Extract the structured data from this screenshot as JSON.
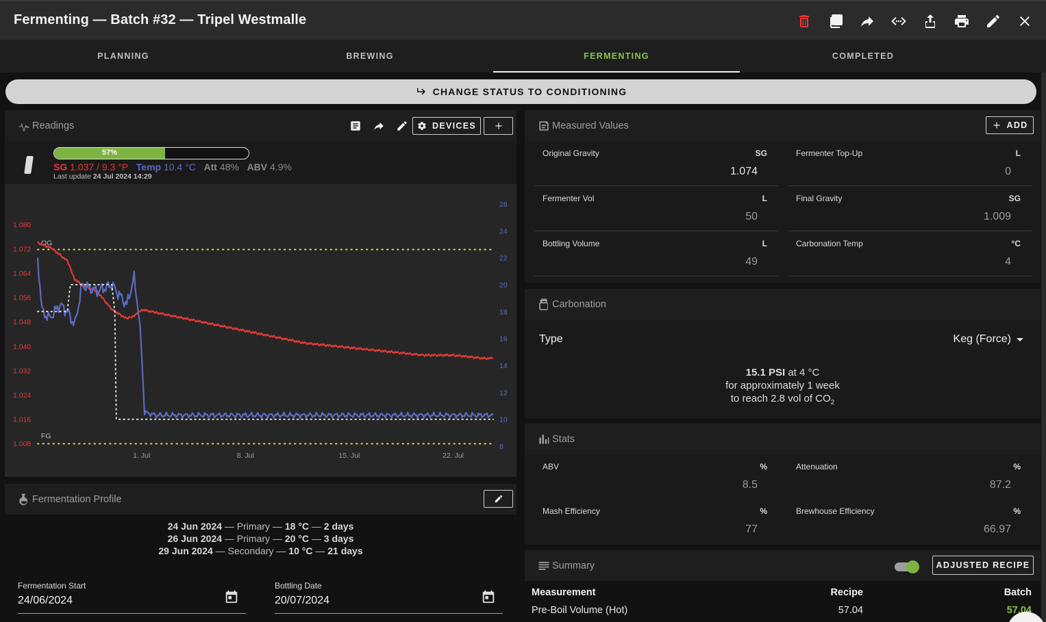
{
  "header": {
    "title": "Fermenting — Batch #32 — Tripel Westmalle"
  },
  "toolbar_icons": [
    "trash-icon",
    "copy-icon",
    "share-icon",
    "code-icon",
    "upload-icon",
    "print-icon",
    "edit-icon",
    "close-icon"
  ],
  "tabs": [
    {
      "label": "PLANNING"
    },
    {
      "label": "BREWING"
    },
    {
      "label": "FERMENTING"
    },
    {
      "label": "COMPLETED"
    }
  ],
  "status_button": {
    "label": "CHANGE STATUS TO CONDITIONING"
  },
  "readings": {
    "title": "Readings",
    "devices_label": "DEVICES",
    "progress": {
      "percent": 57,
      "label": "57%"
    },
    "sg_label": "SG",
    "sg_value": "1.037 / 9.3 °P",
    "temp_label": "Temp",
    "temp_value": "10.4 °C",
    "att_label": "Att",
    "att_value": "48%",
    "abv_label": "ABV",
    "abv_value": "4.9%",
    "last_update_label": "Last update",
    "last_update_value": "24 Jul 2024 14:29"
  },
  "chart_data": {
    "type": "line",
    "x_ticks": [
      "1. Jul",
      "8. Jul",
      "15. Jul",
      "22. Jul"
    ],
    "x_tick_days": [
      7,
      14,
      21,
      28
    ],
    "x_range_days": [
      0,
      30.7
    ],
    "y_left_ticks": [
      "1.080",
      "1.072",
      "1.064",
      "1.056",
      "1.048",
      "1.040",
      "1.032",
      "1.024",
      "1.016",
      "1.008"
    ],
    "y_left_range": [
      1.008,
      1.08
    ],
    "y_right_ticks": [
      "26",
      "24",
      "22",
      "20",
      "18",
      "16",
      "14",
      "12",
      "10",
      "8"
    ],
    "y_right_range": [
      8,
      26
    ],
    "og_label": "OG",
    "og_value": 1.074,
    "fg_label": "FG",
    "fg_value": 1.009,
    "series": [
      {
        "color": "#e53935",
        "axis": "left",
        "points": [
          [
            0,
            1.074
          ],
          [
            1,
            1.072
          ],
          [
            2,
            1.068
          ],
          [
            2.5,
            1.062
          ],
          [
            3,
            1.06
          ],
          [
            4,
            1.058
          ],
          [
            5,
            1.052
          ],
          [
            6,
            1.049
          ],
          [
            6.5,
            1.05
          ],
          [
            7,
            1.052
          ],
          [
            8,
            1.051
          ],
          [
            10,
            1.049
          ],
          [
            12,
            1.047
          ],
          [
            14,
            1.045
          ],
          [
            16,
            1.043
          ],
          [
            18,
            1.041
          ],
          [
            20,
            1.04
          ],
          [
            22,
            1.039
          ],
          [
            24,
            1.038
          ],
          [
            26,
            1.037
          ],
          [
            28,
            1.037
          ],
          [
            30,
            1.036
          ],
          [
            30.7,
            1.036
          ]
        ]
      },
      {
        "color": "#5c6bc0",
        "axis": "right",
        "points": [
          [
            0,
            22
          ],
          [
            0.3,
            18
          ],
          [
            0.8,
            17.5
          ],
          [
            1.5,
            18.5
          ],
          [
            2,
            18
          ],
          [
            2.5,
            17
          ],
          [
            3,
            20
          ],
          [
            4,
            19.5
          ],
          [
            5,
            20
          ],
          [
            6,
            18.5
          ],
          [
            6.5,
            20.5
          ],
          [
            6.8,
            18
          ],
          [
            7,
            15
          ],
          [
            7.2,
            10.5
          ],
          [
            8,
            10.3
          ],
          [
            30.7,
            10.3
          ]
        ]
      },
      {
        "color": "#e0e0e0",
        "axis": "right",
        "dotted": true,
        "points": [
          [
            0,
            18
          ],
          [
            2,
            18
          ],
          [
            2.2,
            20
          ],
          [
            5,
            20
          ],
          [
            5.2,
            18
          ],
          [
            5.3,
            10
          ],
          [
            7,
            10
          ],
          [
            30.7,
            10
          ]
        ]
      }
    ]
  },
  "fermentation_profile": {
    "title": "Fermentation Profile",
    "steps": [
      {
        "date": "24 Jun 2024",
        "sep1": " — Primary — ",
        "temp": "18 °C",
        "sep2": " — ",
        "duration": "2 days"
      },
      {
        "date": "26 Jun 2024",
        "sep1": " — Primary — ",
        "temp": "20 °C",
        "sep2": " — ",
        "duration": "3 days"
      },
      {
        "date": "29 Jun 2024",
        "sep1": " — Secondary — ",
        "temp": "10 °C",
        "sep2": " — ",
        "duration": "21 days"
      }
    ],
    "start_label": "Fermentation Start",
    "start_value": "24/06/2024",
    "bottling_label": "Bottling Date",
    "bottling_value": "20/07/2024"
  },
  "measured_values": {
    "title": "Measured Values",
    "add_label": "ADD",
    "cells": [
      {
        "label": "Original Gravity",
        "unit": "SG",
        "value": "1.074"
      },
      {
        "label": "Fermenter Top-Up",
        "unit": "L",
        "value": "0"
      },
      {
        "label": "Fermenter Vol",
        "unit": "L",
        "value": "50"
      },
      {
        "label": "Final Gravity",
        "unit": "SG",
        "value": "1.009"
      },
      {
        "label": "Bottling Volume",
        "unit": "L",
        "value": "49"
      },
      {
        "label": "Carbonation Temp",
        "unit": "°C",
        "value": "4"
      }
    ]
  },
  "carbonation": {
    "title": "Carbonation",
    "type_label": "Type",
    "type_value": "Keg (Force)",
    "psi": "15.1 PSI",
    "at_temp": " at 4 °C",
    "line2": "for approximately 1 week",
    "line3": "to reach 2.8 vol of CO",
    "line3_sub": "2"
  },
  "stats": {
    "title": "Stats",
    "cells": [
      {
        "label": "ABV",
        "unit": "%",
        "value": "8.5"
      },
      {
        "label": "Attenuation",
        "unit": "%",
        "value": "87.2"
      },
      {
        "label": "Mash Efficiency",
        "unit": "%",
        "value": "77"
      },
      {
        "label": "Brewhouse Efficiency",
        "unit": "%",
        "value": "66.97"
      }
    ]
  },
  "summary": {
    "title": "Summary",
    "toggle_on": true,
    "adjusted_label": "ADJUSTED RECIPE",
    "headers": {
      "measurement": "Measurement",
      "recipe": "Recipe",
      "batch": "Batch"
    },
    "rows": [
      {
        "measurement": "Pre-Boil Volume (Hot)",
        "recipe": "57.04",
        "batch": "57.04"
      }
    ]
  },
  "colors": {
    "accent_green": "#8bc34a",
    "sg_red": "#e53935",
    "temp_blue": "#5c6bc0",
    "og_fg_yellow": "#e8d44d"
  }
}
